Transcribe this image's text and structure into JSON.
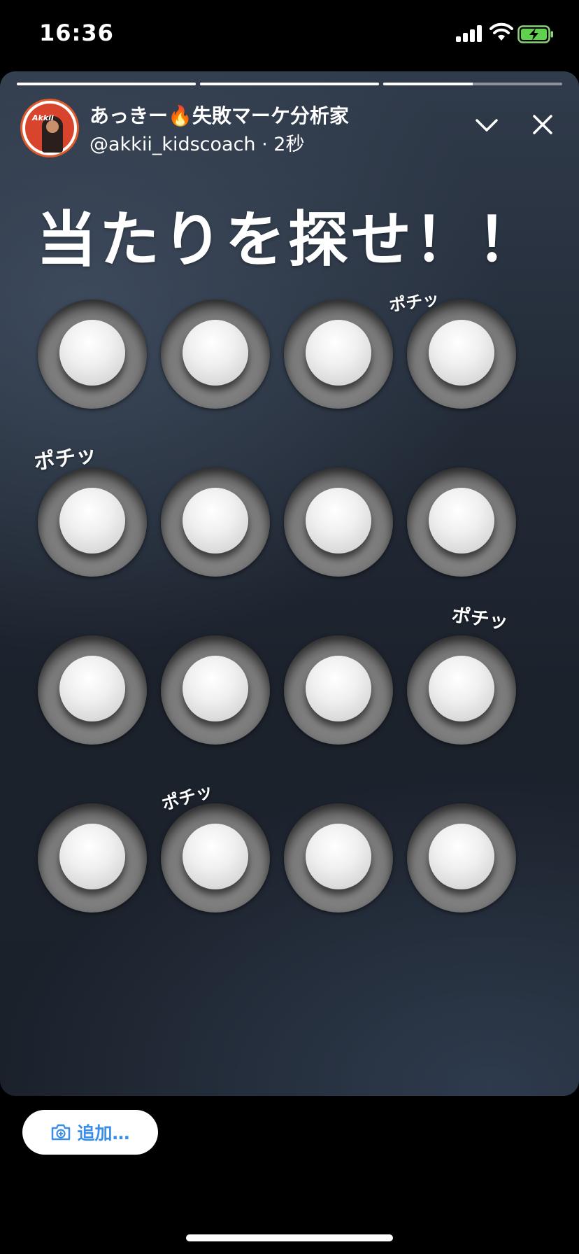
{
  "status_bar": {
    "time": "16:36"
  },
  "story": {
    "progress": [
      1.0,
      1.0,
      0.5
    ],
    "author": {
      "name": "あっきー🔥失敗マーケ分析家",
      "handle": "@akkii_kidscoach",
      "elapsed": "2秒",
      "avatar_logo": "Akkii"
    },
    "headline": "当たりを探せ！！",
    "sound_effects": [
      "ポチッ",
      "ポチッ",
      "ポチッ",
      "ポチッ"
    ],
    "buttons": {
      "rows": 4,
      "columns": 4
    }
  },
  "add_button": {
    "label": "追加…"
  },
  "colors": {
    "accent_blue": "#3b8ee8",
    "avatar_ring": "#e05a2a",
    "story_bg": "#1c222c"
  }
}
